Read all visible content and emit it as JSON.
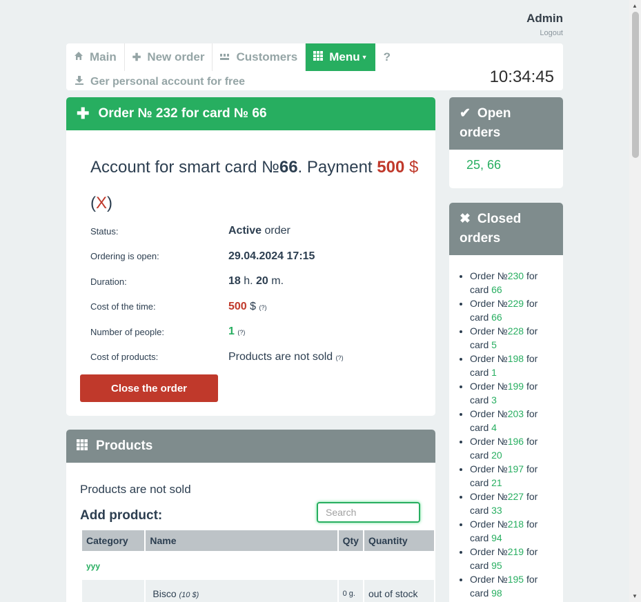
{
  "user": {
    "name": "Admin",
    "logout": "Logout"
  },
  "nav": {
    "tabs": [
      {
        "label": "Main",
        "icon": "home-icon"
      },
      {
        "label": "New order",
        "icon": "plus-icon"
      },
      {
        "label": "Customers",
        "icon": "users-icon"
      },
      {
        "label": "Menu",
        "icon": "grid-icon"
      },
      {
        "label": "?"
      }
    ],
    "sub": "Ger personal account for free",
    "clock": "10:34:45"
  },
  "order": {
    "header": "Order № 232 for card № 66",
    "account_prefix": "Account for smart card №",
    "card": "66",
    "payment_label": ". Payment ",
    "payment": "500",
    "currency": "$",
    "cancel": "X",
    "rows": [
      {
        "label": "Status:",
        "value_bold": "Active",
        "value_rest": " order"
      },
      {
        "label": "Ordering is open:",
        "value_bold": "29.04.2024 17:15"
      },
      {
        "label": "Duration:",
        "hours": "18",
        "h": " h. ",
        "minutes": "20",
        "m": " m."
      },
      {
        "label": "Cost of the time:",
        "value": "500",
        "currency": " $ ",
        "help": "(?)"
      },
      {
        "label": "Number of people:",
        "value": "1",
        "help": "(?)"
      },
      {
        "label": "Cost of products:",
        "value": "Products are not sold ",
        "help": "(?)"
      }
    ],
    "close_button": "Close the order"
  },
  "products": {
    "header": "Products",
    "not_sold": "Products are not sold",
    "add": "Add product:",
    "search_placeholder": "Search",
    "columns": [
      "Category",
      "Name",
      "Qty",
      "Quantity"
    ],
    "category_row": "yyy",
    "item": {
      "name": "Bisco",
      "price": "(10 $)",
      "qty": "0 g.",
      "quantity": "out of stock"
    }
  },
  "open_orders": {
    "header_line1": "Open",
    "header_line2": "orders",
    "cards": "25,  66"
  },
  "closed_orders": {
    "header_line1": "Closed",
    "header_line2": "orders",
    "items": [
      {
        "order": "230",
        "card": "66"
      },
      {
        "order": "229",
        "card": "66"
      },
      {
        "order": "228",
        "card": "5"
      },
      {
        "order": "198",
        "card": "1"
      },
      {
        "order": "199",
        "card": "3"
      },
      {
        "order": "203",
        "card": "4"
      },
      {
        "order": "196",
        "card": "20"
      },
      {
        "order": "197",
        "card": "21"
      },
      {
        "order": "227",
        "card": "33"
      },
      {
        "order": "218",
        "card": "94"
      },
      {
        "order": "219",
        "card": "95"
      },
      {
        "order": "195",
        "card": "98"
      }
    ],
    "order_prefix": "Order №",
    "card_word": " for card "
  },
  "colors": {
    "green": "#27ae60",
    "red": "#c0392b",
    "gray": "#7f8c8d",
    "background": "#ecf0f1"
  }
}
